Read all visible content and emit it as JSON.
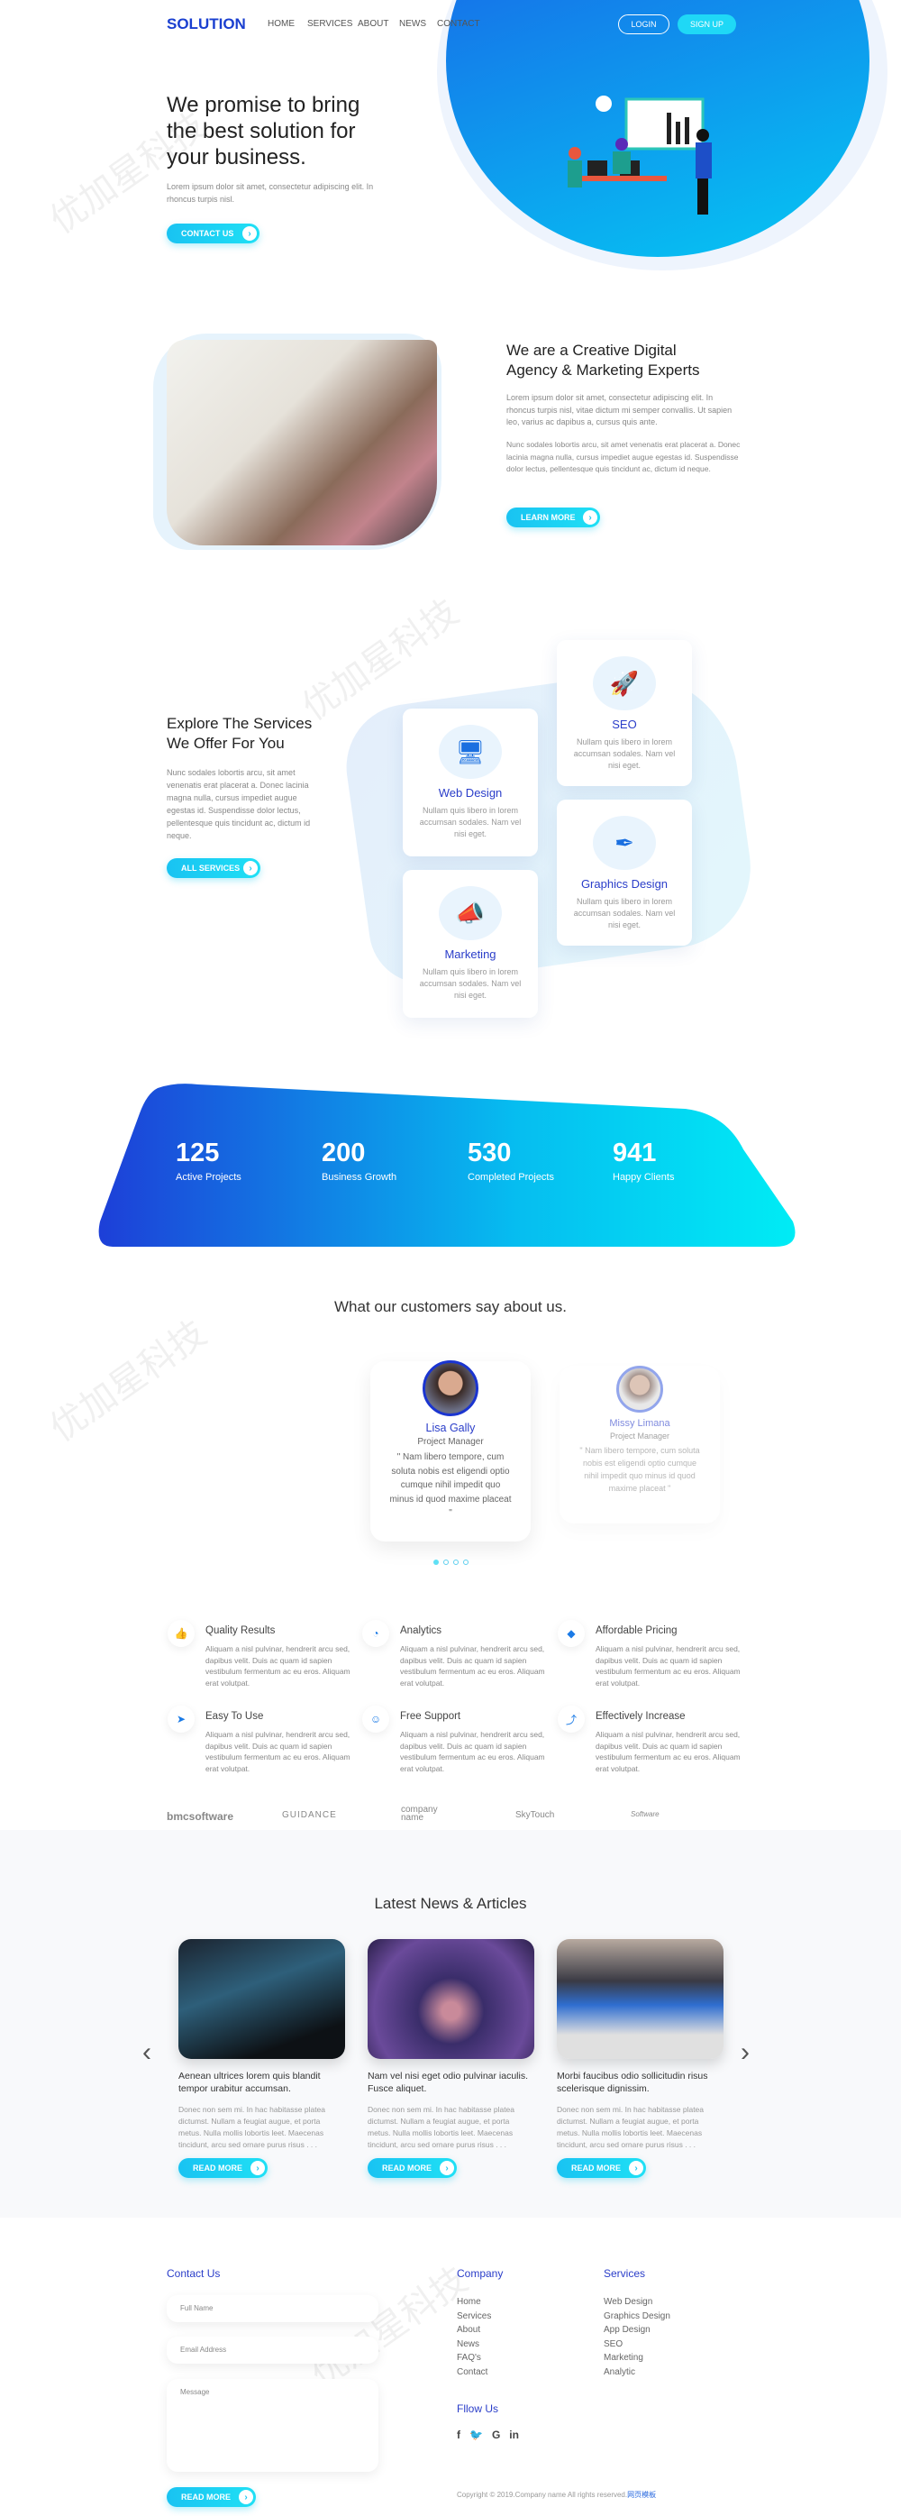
{
  "nav": {
    "logo": "SOLUTION",
    "links": [
      "HOME",
      "SERVICES",
      "ABOUT",
      "NEWS",
      "CONTACT"
    ],
    "login": "LOGIN",
    "signup": "SIGN UP"
  },
  "hero": {
    "line1": "We promise to bring",
    "line2a": "the best ",
    "line2b": "solution",
    "line2c": " for",
    "line3": "your business.",
    "text": "Lorem ipsum dolor sit amet, consectetur adipiscing elit. In rhoncus turpis nisl.",
    "button": "CONTACT US"
  },
  "about": {
    "title1": "We are a Creative Digital",
    "title2": "Agency & Marketing Experts",
    "p1": "Lorem ipsum dolor sit amet, consectetur adipiscing elit. In rhoncus turpis nisl, vitae dictum mi semper convallis. Ut sapien leo, varius ac dapibus a, cursus quis ante.",
    "p2": "Nunc sodales lobortis arcu, sit amet venenatis erat placerat a. Donec lacinia magna nulla, cursus impediet augue egestas id. Suspendisse dolor lectus, pellentesque quis tincidunt ac, dictum id neque.",
    "button": "LEARN MORE"
  },
  "services": {
    "title1": "Explore The Services",
    "title2": "We Offer For You",
    "text": "Nunc sodales lobortis arcu, sit amet venenatis erat placerat a. Donec lacinia magna nulla, cursus impediet augue egestas id. Suspendisse dolor lectus, pellentesque quis tincidunt ac, dictum id neque.",
    "button": "ALL SERVICES",
    "cards": [
      {
        "title": "Web Design",
        "text": "Nullam quis libero in lorem accumsan sodales. Nam vel nisi eget.",
        "icon": "monitor-icon"
      },
      {
        "title": "SEO",
        "text": "Nullam quis libero in lorem accumsan sodales. Nam vel nisi eget.",
        "icon": "rocket-icon"
      },
      {
        "title": "Graphics Design",
        "text": "Nullam quis libero in lorem accumsan sodales. Nam vel nisi eget.",
        "icon": "pen-tool-icon"
      },
      {
        "title": "Marketing",
        "text": "Nullam quis libero in lorem accumsan sodales. Nam vel nisi eget.",
        "icon": "megaphone-icon"
      }
    ]
  },
  "stats": [
    {
      "value": "125",
      "label": "Active Projects"
    },
    {
      "value": "200",
      "label": "Business Growth"
    },
    {
      "value": "530",
      "label": "Completed Projects"
    },
    {
      "value": "941",
      "label": "Happy Clients"
    }
  ],
  "testimonials": {
    "title": "What our customers say about us.",
    "items": [
      {
        "name": "Lisa Gally",
        "role": "Project Manager",
        "quote": "\" Nam libero tempore, cum soluta nobis est eligendi optio cumque nihil impedit quo minus id quod maxime placeat \""
      },
      {
        "name": "Missy Limana",
        "role": "Project Manager",
        "quote": "\" Nam libero tempore, cum soluta nobis est eligendi optio cumque nihil impedit quo minus id quod maxime placeat \""
      }
    ],
    "active_dot": 0
  },
  "features": [
    {
      "title": "Quality Results",
      "icon": "thumbs-up-icon"
    },
    {
      "title": "Analytics",
      "icon": "pie-chart-icon"
    },
    {
      "title": "Affordable Pricing",
      "icon": "tag-icon"
    },
    {
      "title": "Easy To Use",
      "icon": "cursor-icon"
    },
    {
      "title": "Free Support",
      "icon": "headset-icon"
    },
    {
      "title": "Effectively Increase",
      "icon": "arrow-up-icon"
    }
  ],
  "feature_text": "Aliquam a nisl pulvinar, hendrerit arcu sed, dapibus velit. Duis ac quam id sapien vestibulum fermentum ac eu eros. Aliquam erat volutpat.",
  "logos": [
    "bmcsoftware",
    "GUIDANCE",
    "company name",
    "SkyTouch",
    "Software"
  ],
  "news": {
    "title": "Latest News & Articles",
    "items": [
      {
        "title": "Aenean ultrices lorem quis blandit tempor urabitur accumsan."
      },
      {
        "title": "Nam vel nisi eget odio pulvinar iaculis. Fusce aliquet."
      },
      {
        "title": "Morbi faucibus odio sollicitudin risus scelerisque dignissim."
      }
    ],
    "text": "Donec non sem mi. In hac habitasse platea dictumst. Nullam a feugiat augue, et porta metus. Nulla mollis lobortis leet. Maecenas tincidunt, arcu sed ornare purus risus . . .",
    "button": "READ MORE"
  },
  "footer": {
    "contact": "Contact Us",
    "name_ph": "Full Name",
    "email_ph": "Email Address",
    "message_ph": "Message",
    "button": "READ MORE",
    "company": "Company",
    "company_links": [
      "Home",
      "Services",
      "About",
      "News",
      "FAQ's",
      "Contact"
    ],
    "services": "Services",
    "service_links": [
      "Web Design",
      "Graphics Design",
      "App Design",
      "SEO",
      "Marketing",
      "Analytic"
    ],
    "follow": "Fllow Us",
    "social": [
      "facebook-icon",
      "twitter-icon",
      "google-icon",
      "linkedin-icon"
    ],
    "copyright": "Copyright © 2019.Company name All rights reserved.",
    "copyright_link": "网页模板"
  },
  "watermark": "优加星科技",
  "colors": {
    "primary": "#2a3dc9",
    "accent": "#1ccaf3",
    "blob_start": "#1a5ce6",
    "blob_end": "#00e6f5"
  }
}
